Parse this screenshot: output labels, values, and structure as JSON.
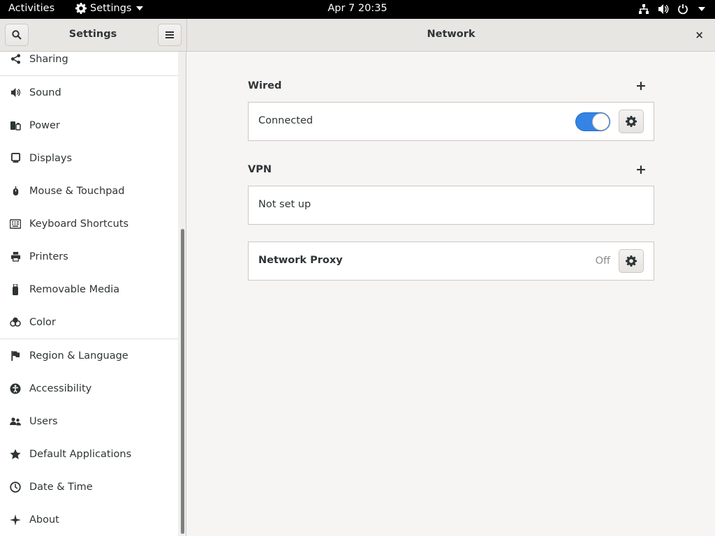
{
  "topbar": {
    "activities": "Activities",
    "app_menu": "Settings",
    "clock": "Apr 7  20:35"
  },
  "header": {
    "sidebar_title": "Settings",
    "main_title": "Network",
    "close": "×"
  },
  "sidebar": {
    "items": [
      {
        "label": "Sharing",
        "icon": "share-icon"
      },
      {
        "label": "Sound",
        "icon": "speaker-icon"
      },
      {
        "label": "Power",
        "icon": "power-plug-icon"
      },
      {
        "label": "Displays",
        "icon": "display-icon"
      },
      {
        "label": "Mouse & Touchpad",
        "icon": "mouse-icon"
      },
      {
        "label": "Keyboard Shortcuts",
        "icon": "keyboard-icon"
      },
      {
        "label": "Printers",
        "icon": "printer-icon"
      },
      {
        "label": "Removable Media",
        "icon": "usb-icon"
      },
      {
        "label": "Color",
        "icon": "color-icon"
      },
      {
        "label": "Region & Language",
        "icon": "flag-icon"
      },
      {
        "label": "Accessibility",
        "icon": "accessibility-icon"
      },
      {
        "label": "Users",
        "icon": "users-icon"
      },
      {
        "label": "Default Applications",
        "icon": "star-icon"
      },
      {
        "label": "Date & Time",
        "icon": "clock-icon"
      },
      {
        "label": "About",
        "icon": "sparkle-icon"
      }
    ]
  },
  "main": {
    "wired": {
      "title": "Wired",
      "status": "Connected",
      "toggle_on": true
    },
    "vpn": {
      "title": "VPN",
      "status": "Not set up"
    },
    "proxy": {
      "label": "Network Proxy",
      "status": "Off"
    }
  },
  "colors": {
    "accent": "#3584e4",
    "topbar": "#000000",
    "sidebar_bg": "#ffffff",
    "main_bg": "#f6f5f4"
  }
}
